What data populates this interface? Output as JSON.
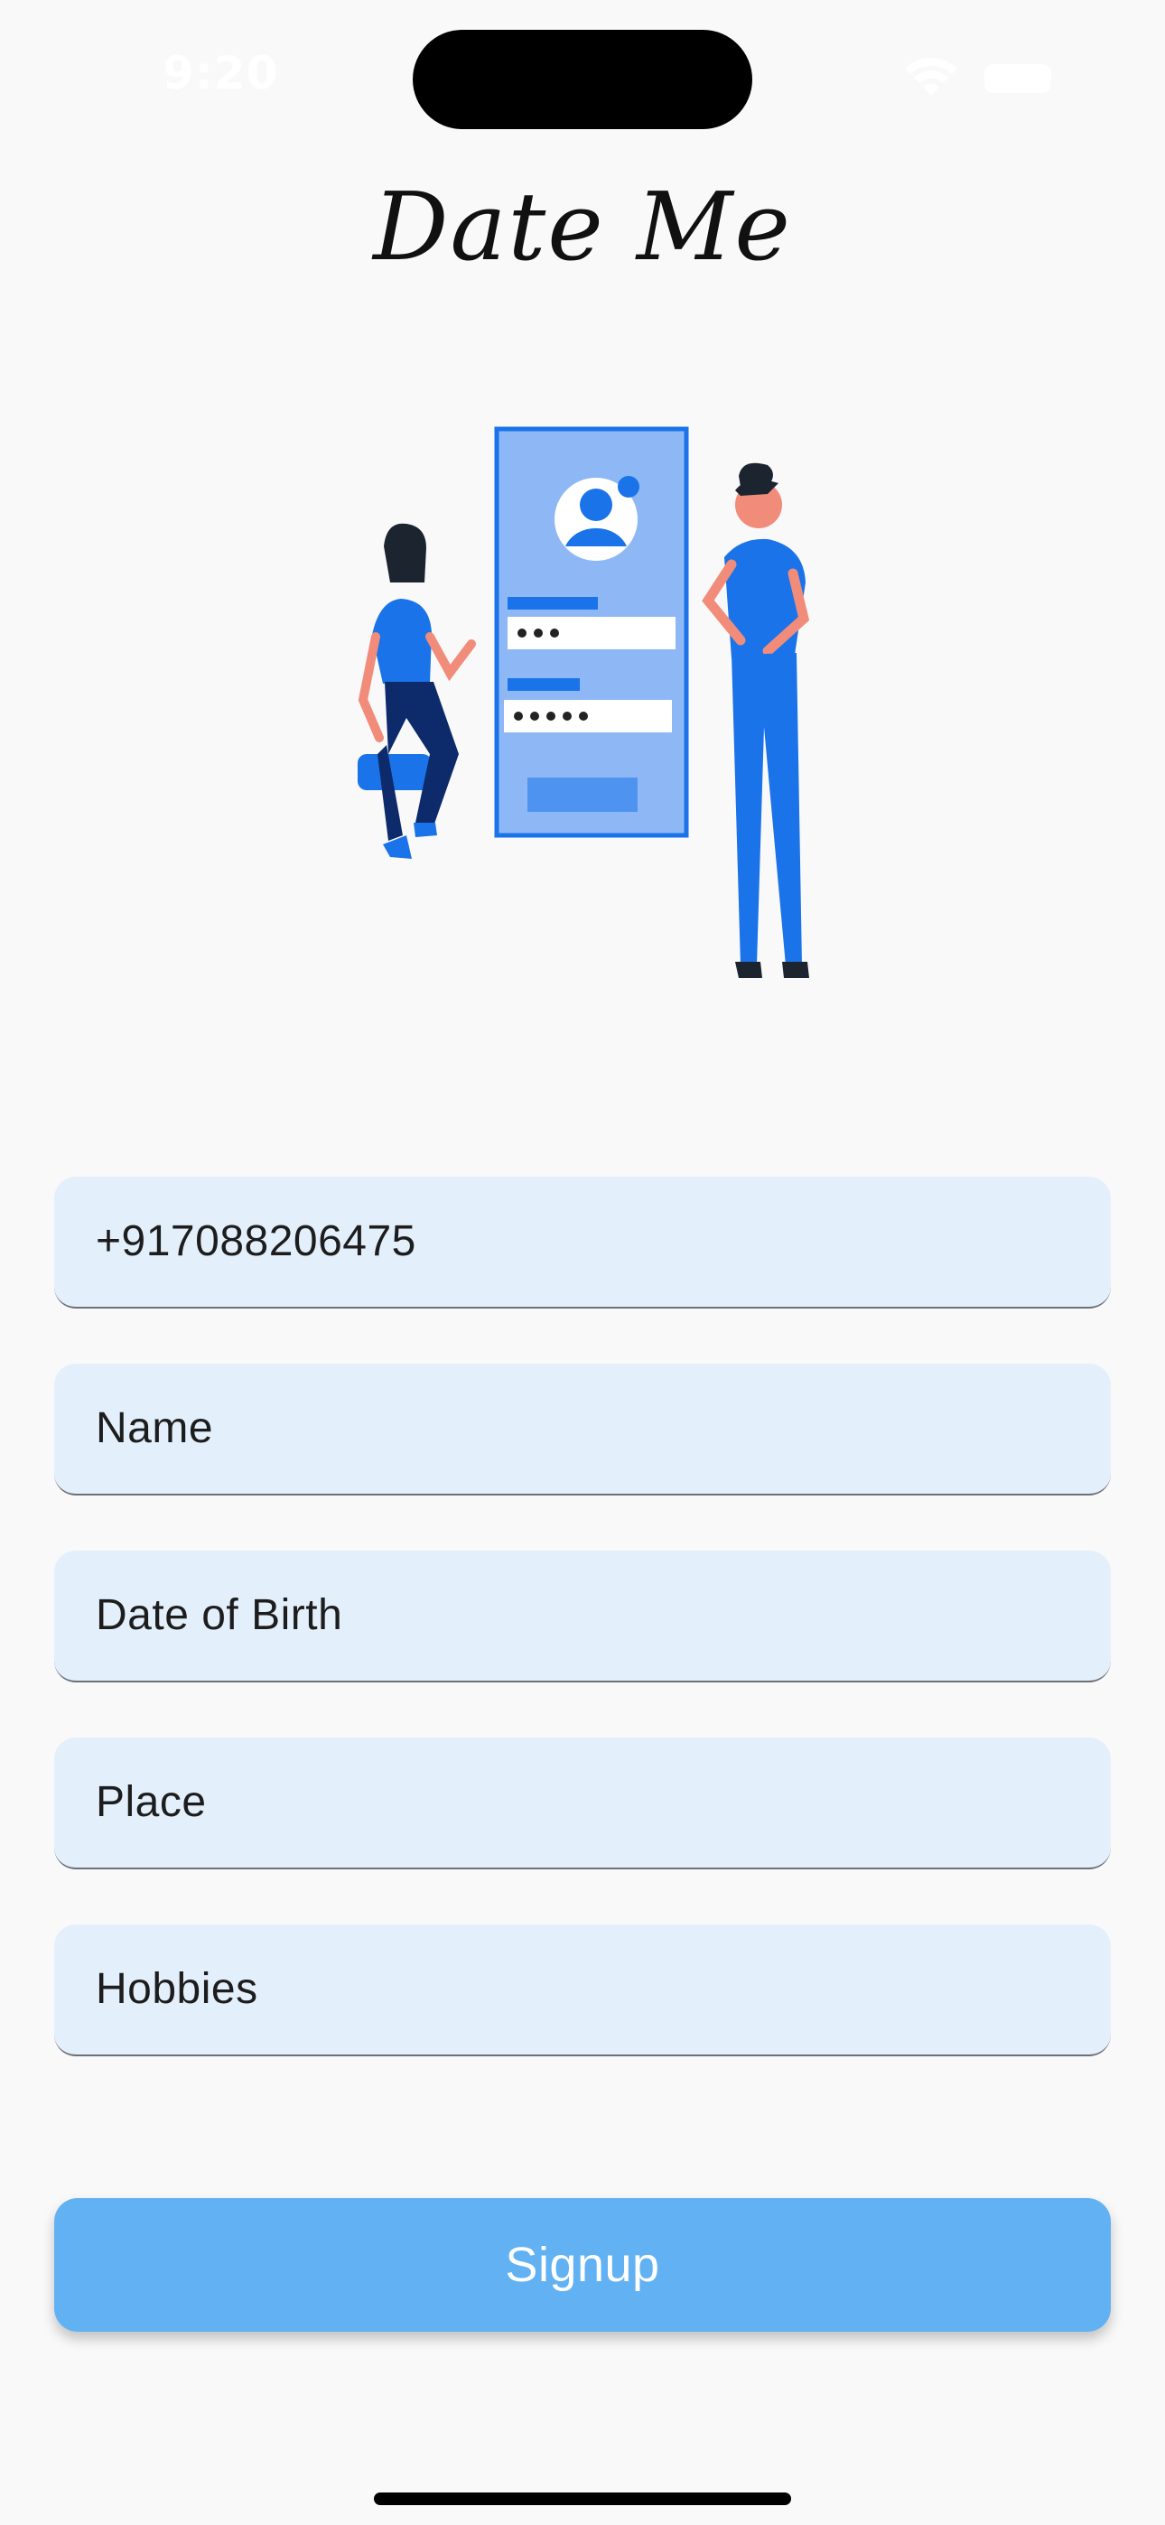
{
  "status_bar": {
    "time": "9:20",
    "icons": [
      "wifi-icon",
      "battery-icon"
    ]
  },
  "app": {
    "title": "Date Me"
  },
  "illustration": {
    "subject": "signup-illustration",
    "colors": {
      "primary": "#1a73e8",
      "panel": "#8db8f5",
      "dark": "#0d2a6b"
    }
  },
  "form": {
    "phone_value": "+917088206475",
    "name_placeholder": "Name",
    "dob_placeholder": "Date of Birth",
    "place_placeholder": "Place",
    "hobbies_placeholder": "Hobbies"
  },
  "signup_button": {
    "label": "Signup",
    "color": "#62b2f3"
  }
}
